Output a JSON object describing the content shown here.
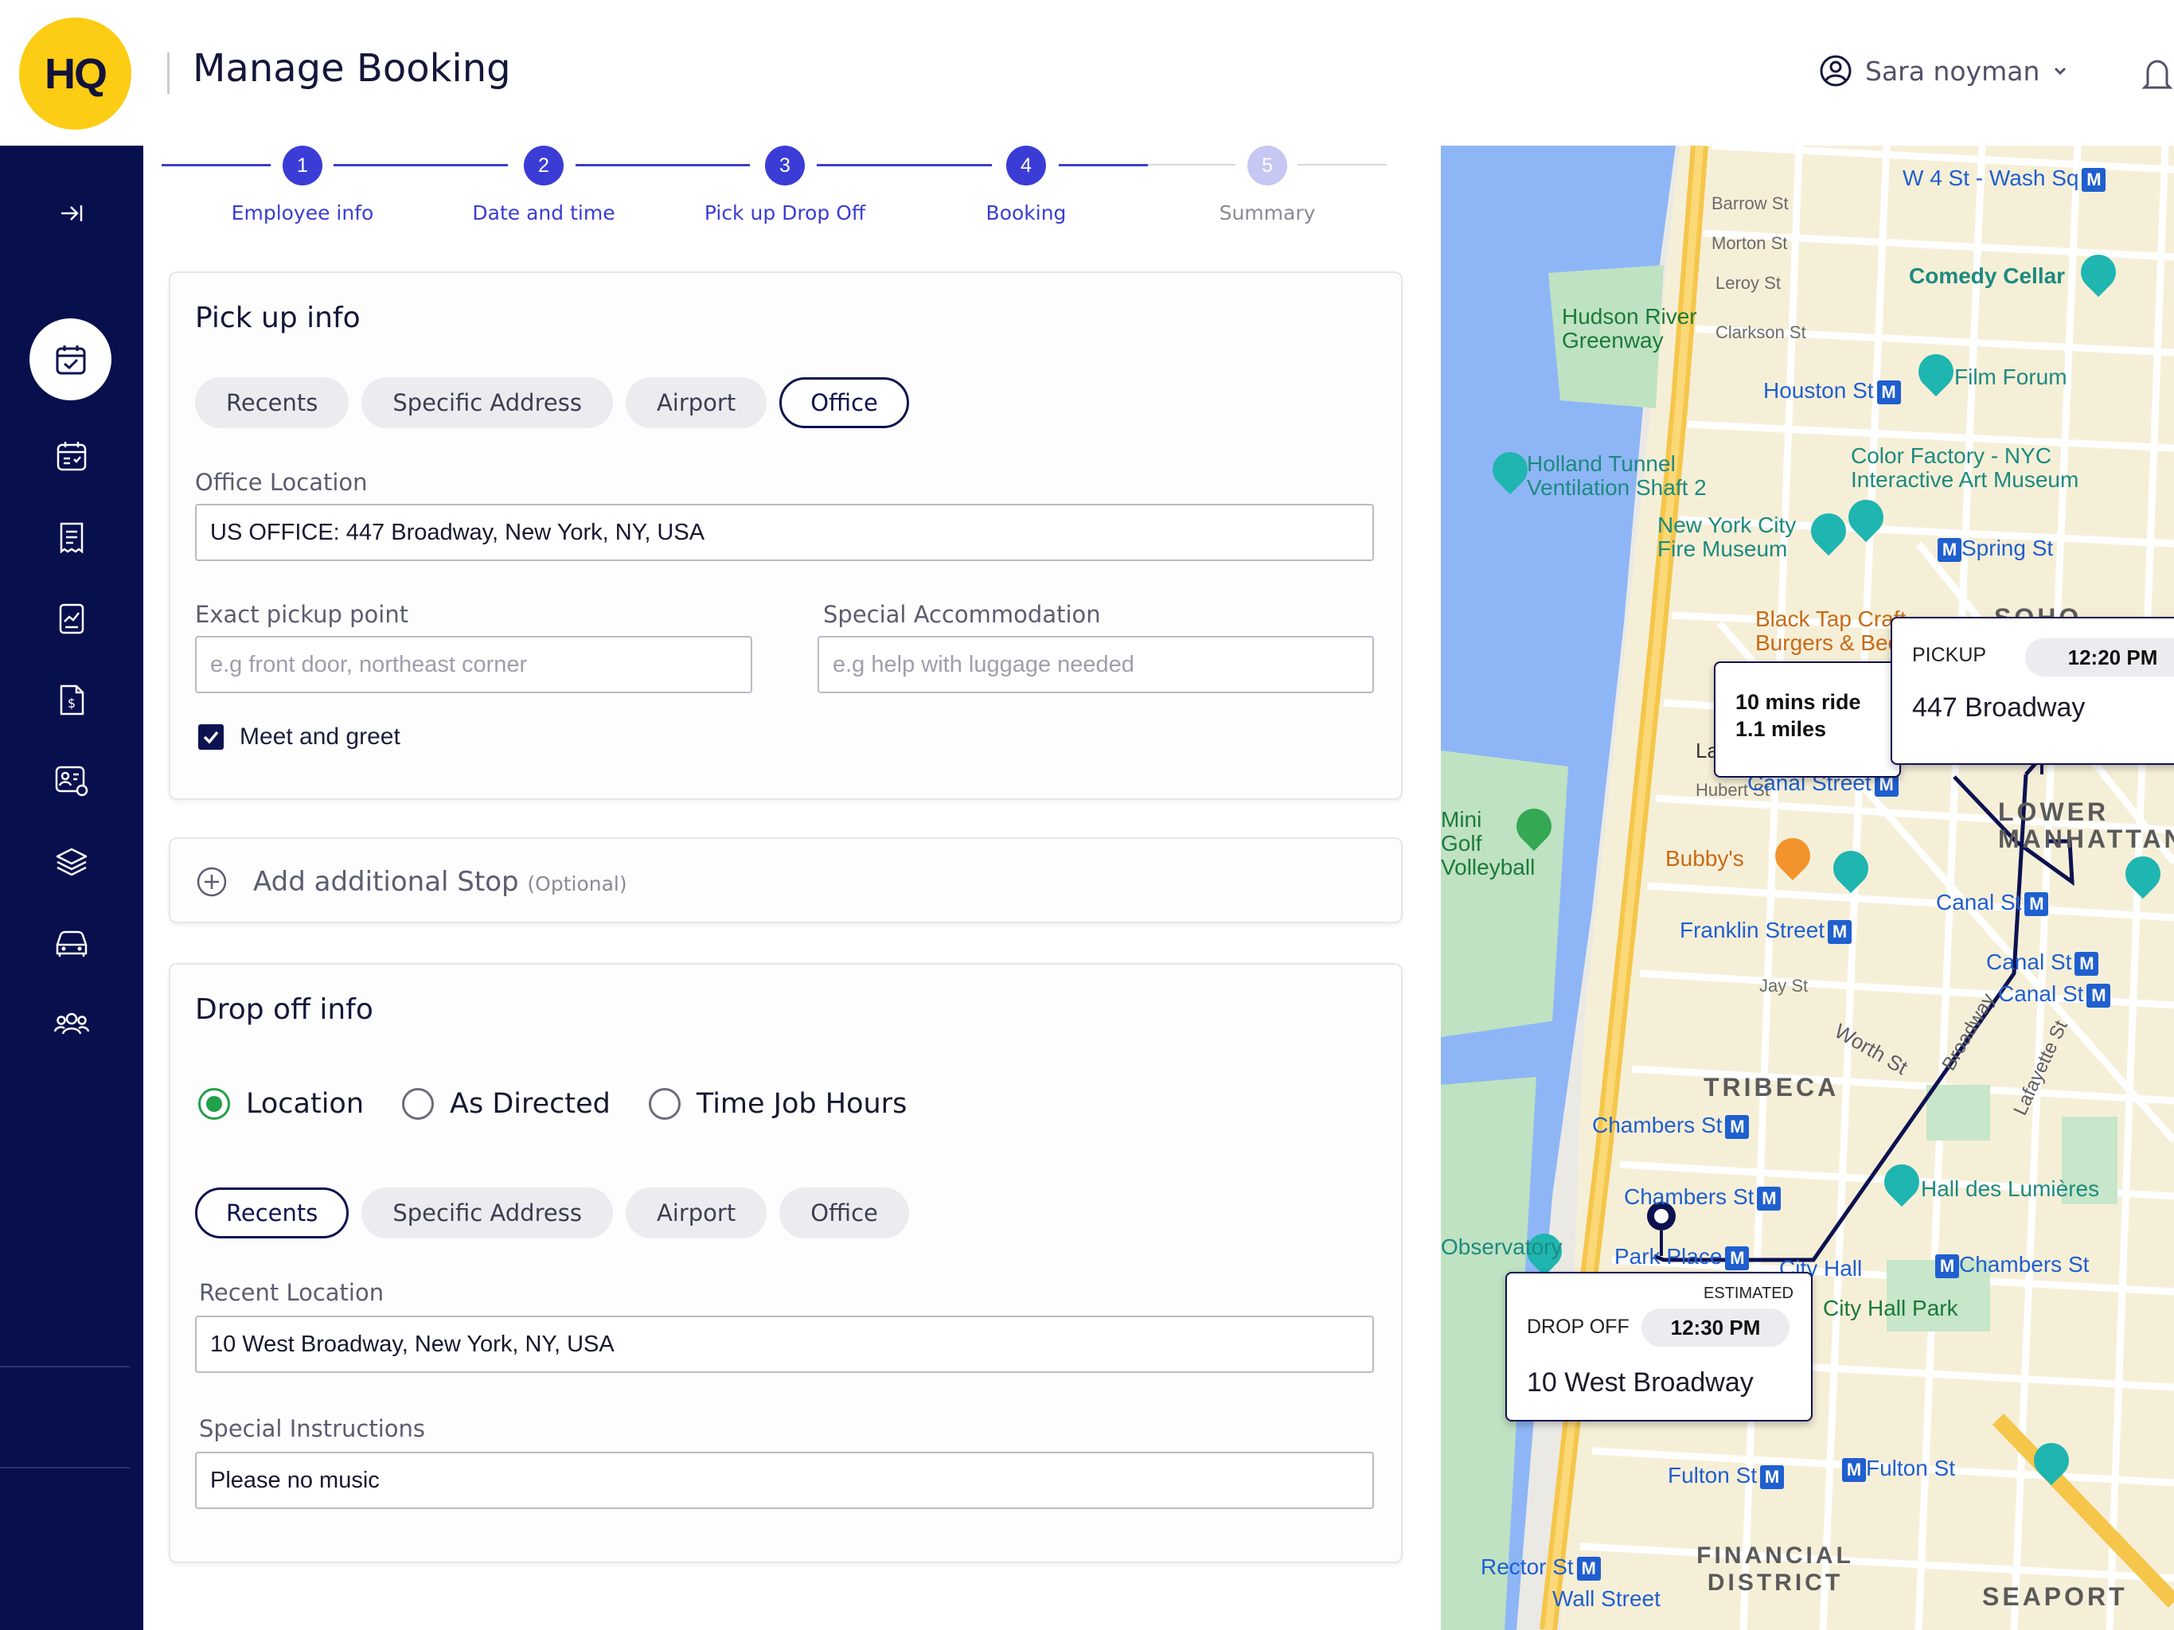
{
  "header": {
    "logo_text": "HQ",
    "page_title": "Manage Booking",
    "user_name": "Sara noyman"
  },
  "sidebar": {
    "items": [
      "collapse",
      "bookings",
      "calendar",
      "receipts",
      "reports",
      "billing",
      "profile-settings",
      "layers",
      "vehicles",
      "team"
    ]
  },
  "stepper": {
    "steps": [
      {
        "num": "1",
        "label": "Employee info",
        "state": "done"
      },
      {
        "num": "2",
        "label": "Date and time",
        "state": "done"
      },
      {
        "num": "3",
        "label": "Pick up Drop Off",
        "state": "done"
      },
      {
        "num": "4",
        "label": "Booking",
        "state": "current"
      },
      {
        "num": "5",
        "label": "Summary",
        "state": "upcoming"
      }
    ]
  },
  "pickup": {
    "title": "Pick up info",
    "tabs": [
      "Recents",
      "Specific Address",
      "Airport",
      "Office"
    ],
    "selected_tab": "Office",
    "office_location_label": "Office Location",
    "office_location_value": "US OFFICE: 447 Broadway, New York, NY, USA",
    "exact_pickup_label": "Exact pickup point",
    "exact_pickup_placeholder": "e.g front door, northeast corner",
    "special_accommodation_label": "Special Accommodation",
    "special_accommodation_placeholder": "e.g help with luggage needed",
    "meet_and_greet_label": "Meet and greet",
    "meet_and_greet_checked": true
  },
  "add_stop": {
    "label": "Add additional Stop",
    "optional": "(Optional)"
  },
  "dropoff": {
    "title": "Drop off info",
    "modes": [
      "Location",
      "As Directed",
      "Time Job Hours"
    ],
    "selected_mode": "Location",
    "tabs": [
      "Recents",
      "Specific Address",
      "Airport",
      "Office"
    ],
    "selected_tab": "Recents",
    "recent_location_label": "Recent Location",
    "recent_location_value": "10 West Broadway, New York, NY, USA",
    "special_instructions_label": "Special Instructions",
    "special_instructions_value": "Please no music"
  },
  "map": {
    "ride_info": {
      "duration": "10 mins ride",
      "distance": "1.1 miles"
    },
    "pickup_card": {
      "label": "PICKUP",
      "time": "12:20 PM",
      "address": "447 Broadway"
    },
    "dropoff_card": {
      "label": "DROP OFF",
      "estimated": "ESTIMATED",
      "time": "12:30 PM",
      "address": "10 West Broadway"
    },
    "labels": {
      "w4st": "W 4 St - Wash Sq",
      "barrow": "Barrow St",
      "morton": "Morton St",
      "leroy": "Leroy St",
      "clarkson": "Clarkson St",
      "comedy": "Comedy Cellar",
      "hudson": "Hudson River Greenway",
      "houston": "Houston St",
      "filmforum": "Film Forum",
      "holland": "Holland Tunnel Ventilation Shaft 2",
      "colorfactory": "Color Factory - NYC Interactive Art Museum",
      "fire": "New York City Fire Museum",
      "spring": "Spring St",
      "blacktap": "Black Tap Craft Burgers & Beer",
      "soho": "SOHO",
      "laight": "Laight St",
      "hubert": "Hubert St",
      "canal1": "Canal Street",
      "golf": "Mini Golf Volleyball",
      "bubbys": "Bubby's",
      "lowermanhattan": "LOWER MANHATTAN",
      "canal2": "Canal St",
      "franklin": "Franklin Street",
      "canal3": "Canal St",
      "canal4": "Canal St",
      "jay": "Jay St",
      "worth": "Worth St",
      "tribeca": "TRIBECA",
      "chambers1": "Chambers St",
      "chambers2": "Chambers St",
      "halldes": "Hall des Lumières",
      "observatory": "Observatory",
      "parkplace": "Park Place",
      "cityhall": "City Hall",
      "chambers3": "Chambers St",
      "cityhallpark": "City Hall Park",
      "fulton1": "Fulton St",
      "fulton2": "Fulton St",
      "financial": "FINANCIAL DISTRICT",
      "rector": "Rector St",
      "wallst": "Wall Street",
      "seaport": "SEAPORT",
      "broadway": "Broadway",
      "lafayette": "Lafayette St"
    }
  },
  "colors": {
    "sidebar_bg": "#080f4d",
    "accent": "#3b3cd6",
    "logo_yellow": "#fdcc14",
    "route": "#0c1250",
    "radio_on": "#22a04a"
  }
}
